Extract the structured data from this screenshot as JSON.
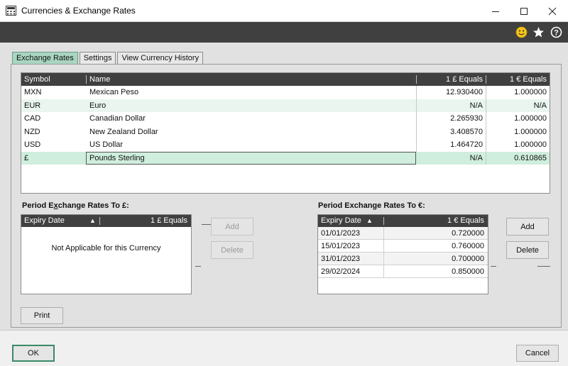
{
  "window": {
    "title": "Currencies & Exchange Rates",
    "icon": "calculator-icon",
    "controls": {
      "minimize": "—",
      "maximize": "☐",
      "close": "✕"
    }
  },
  "toolbar": {
    "icons": [
      "smiley-icon",
      "star-icon",
      "help-icon"
    ],
    "colors": {
      "smiley": "#f5c518",
      "star": "#ffffff",
      "help": "#ffffff"
    }
  },
  "tabs": [
    {
      "label": "Exchange Rates",
      "active": true
    },
    {
      "label": "Settings",
      "active": false
    },
    {
      "label": "View Currency History",
      "active": false
    }
  ],
  "currency_grid": {
    "columns": [
      "Symbol",
      "Name",
      "1 £ Equals",
      "1 € Equals"
    ],
    "rows": [
      {
        "symbol": "MXN",
        "name": "Mexican Peso",
        "gbp": "12.930400",
        "eur": "1.000000"
      },
      {
        "symbol": "EUR",
        "name": "Euro",
        "gbp": "N/A",
        "eur": "N/A"
      },
      {
        "symbol": "CAD",
        "name": "Canadian Dollar",
        "gbp": "2.265930",
        "eur": "1.000000"
      },
      {
        "symbol": "NZD",
        "name": "New Zealand Dollar",
        "gbp": "3.408570",
        "eur": "1.000000"
      },
      {
        "symbol": "USD",
        "name": "US Dollar",
        "gbp": "1.464720",
        "eur": "1.000000"
      },
      {
        "symbol": "£",
        "name": "Pounds Sterling",
        "gbp": "N/A",
        "eur": "0.610865"
      }
    ]
  },
  "period_gbp": {
    "label_pre": "Period E",
    "label_u": "x",
    "label_post": "change Rates To £:",
    "columns": [
      "Expiry Date",
      "1 £ Equals"
    ],
    "empty_text": "Not Applicable for this Currency",
    "add_label": "Add",
    "delete_label": "Delete"
  },
  "period_eur": {
    "label_pre": "Period Exchan",
    "label_u": "g",
    "label_post": "e Rates To €:",
    "columns": [
      "Expiry Date",
      "1 € Equals"
    ],
    "rows": [
      {
        "date": "01/01/2023",
        "value": "0.720000"
      },
      {
        "date": "15/01/2023",
        "value": "0.760000"
      },
      {
        "date": "31/01/2023",
        "value": "0.700000"
      },
      {
        "date": "29/02/2024",
        "value": "0.850000"
      }
    ],
    "add_label": "Add",
    "delete_label": "Delete"
  },
  "buttons": {
    "print": "Print",
    "ok": "OK",
    "cancel": "Cancel"
  },
  "sort_indicator": "▲"
}
